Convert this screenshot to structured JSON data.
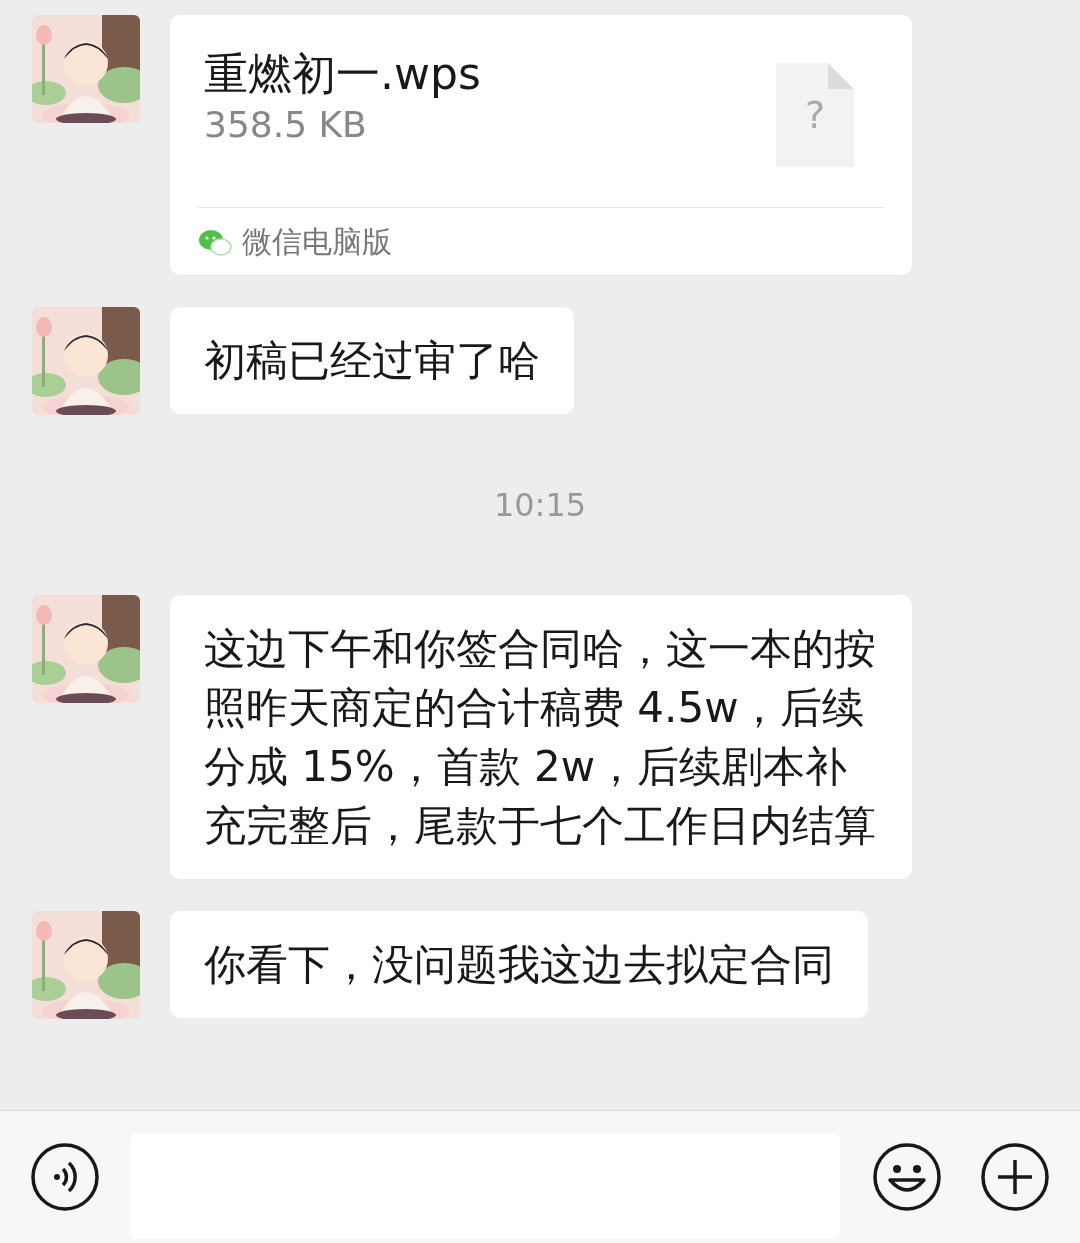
{
  "messages": [
    {
      "kind": "file",
      "file_name": "重燃初一.wps",
      "file_size": "358.5  KB",
      "file_icon_glyph": "?",
      "source": "微信电脑版"
    },
    {
      "kind": "text",
      "text": "初稿已经过审了哈"
    },
    {
      "kind": "time",
      "text": "10:15"
    },
    {
      "kind": "text",
      "text": "这边下午和你签合同哈，这一本的按照昨天商定的合计稿费 4.5w，后续分成 15%，首款 2w，后续剧本补充完整后，尾款于七个工作日内结算"
    },
    {
      "kind": "text",
      "text": "你看下，没问题我这边去拟定合同"
    }
  ]
}
